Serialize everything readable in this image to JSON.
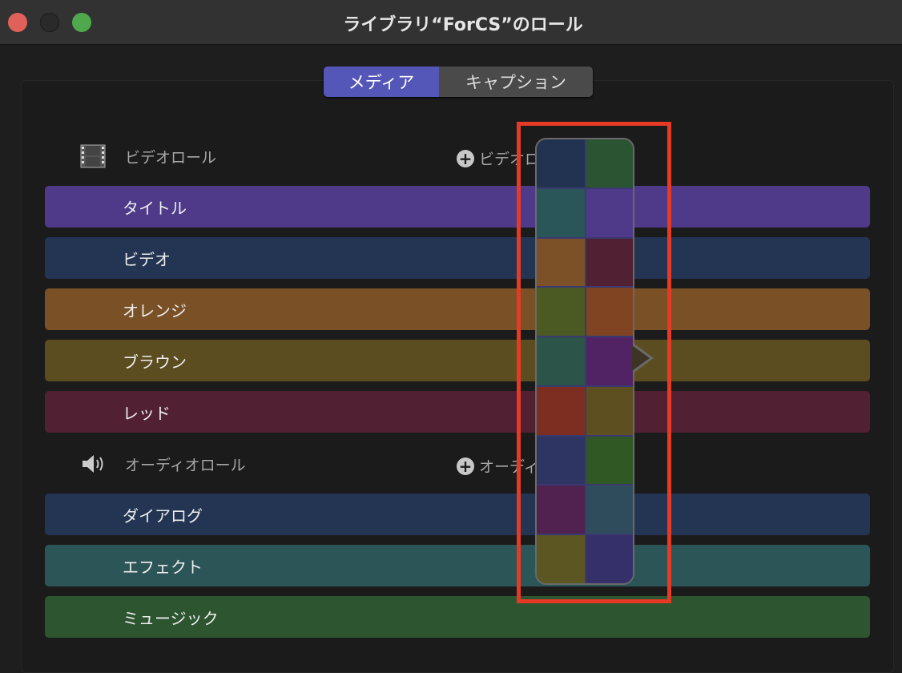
{
  "window": {
    "title": "ライブラリ“ForCS”のロール"
  },
  "tabs": [
    {
      "label": "メディア",
      "selected": true
    },
    {
      "label": "キャプション",
      "selected": false
    }
  ],
  "video_section": {
    "label": "ビデオロール",
    "add_label": "ビデオロ",
    "roles": [
      {
        "label": "タイトル",
        "color": "#4f3a8a"
      },
      {
        "label": "ビデオ",
        "color": "#233553"
      },
      {
        "label": "オレンジ",
        "color": "#7a5126"
      },
      {
        "label": "ブラウン",
        "color": "#5c4d20"
      },
      {
        "label": "レッド",
        "color": "#522033"
      }
    ]
  },
  "audio_section": {
    "label": "オーディオロール",
    "add_label": "オーディ",
    "roles": [
      {
        "label": "ダイアログ",
        "color": "#233553"
      },
      {
        "label": "エフェクト",
        "color": "#2c5558"
      },
      {
        "label": "ミュージック",
        "color": "#2c5530"
      }
    ]
  },
  "color_picker": {
    "swatches": [
      "#223352",
      "#2b5433",
      "#2b5659",
      "#4e3a89",
      "#7d5127",
      "#512033",
      "#4a5a22",
      "#814422",
      "#2c5448",
      "#522364",
      "#7e2e20",
      "#5e4f20",
      "#2e3563",
      "#305824",
      "#512150",
      "#2f4c5c",
      "#5c5622",
      "#36306a"
    ]
  },
  "highlight_color": "#e63a25"
}
